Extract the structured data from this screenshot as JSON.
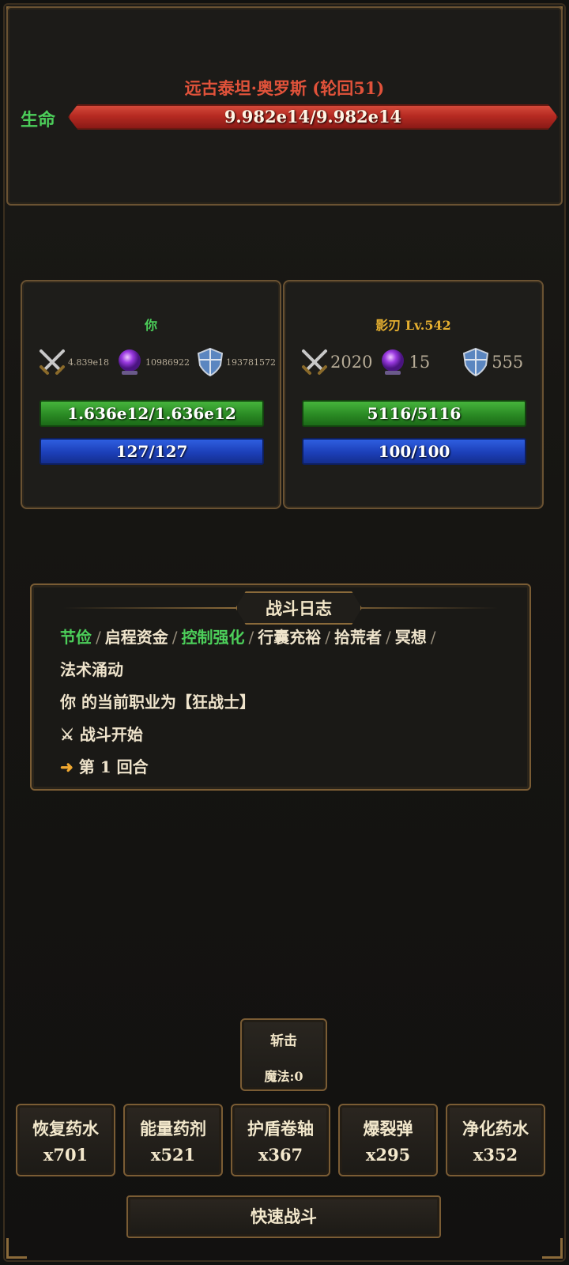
{
  "boss": {
    "name": "远古泰坦·奥罗斯 (轮回51)",
    "hp_label": "生命",
    "hp_text": "9.982e14/9.982e14",
    "hp_fraction": 1.0
  },
  "player": {
    "name": "你",
    "attack": "4.839e18",
    "magic": "10986922",
    "defense": "193781572",
    "hp": "1.636e12/1.636e12",
    "mp": "127/127"
  },
  "enemy": {
    "name": "影刃 Lv.542",
    "attack": "2020",
    "magic": "15",
    "defense": "555",
    "hp": "5116/5116",
    "mp": "100/100"
  },
  "log": {
    "title": "战斗日志",
    "traits": [
      {
        "text": "节俭",
        "highlight": true
      },
      {
        "text": "启程资金",
        "highlight": false
      },
      {
        "text": "控制强化",
        "highlight": true
      },
      {
        "text": "行囊充裕",
        "highlight": false
      },
      {
        "text": "拾荒者",
        "highlight": false
      },
      {
        "text": "冥想",
        "highlight": false
      }
    ],
    "trait_overflow": "法术涌动",
    "job_line": "你 的当前职业为【狂战士】",
    "battle_start": "战斗开始",
    "battle_start_icon": "⚔",
    "round_text": "第 1 回合",
    "round_icon": "➜"
  },
  "skill": {
    "name": "斩击",
    "cost": "魔法:0"
  },
  "items": [
    {
      "name": "恢复药水",
      "count": "x701"
    },
    {
      "name": "能量药剂",
      "count": "x521"
    },
    {
      "name": "护盾卷轴",
      "count": "x367"
    },
    {
      "name": "爆裂弹",
      "count": "x295"
    },
    {
      "name": "净化药水",
      "count": "x352"
    }
  ],
  "quick_battle": "快速战斗",
  "colors": {
    "hp_green": "#4ccf5a",
    "boss_red": "#e0523a",
    "enemy_gold": "#e6b030",
    "mp_blue": "#1c3fb8",
    "border_bronze": "#7a5c34"
  },
  "icons": {
    "attack": "crossed-swords-icon",
    "magic": "purple-orb-icon",
    "defense": "shield-icon"
  }
}
